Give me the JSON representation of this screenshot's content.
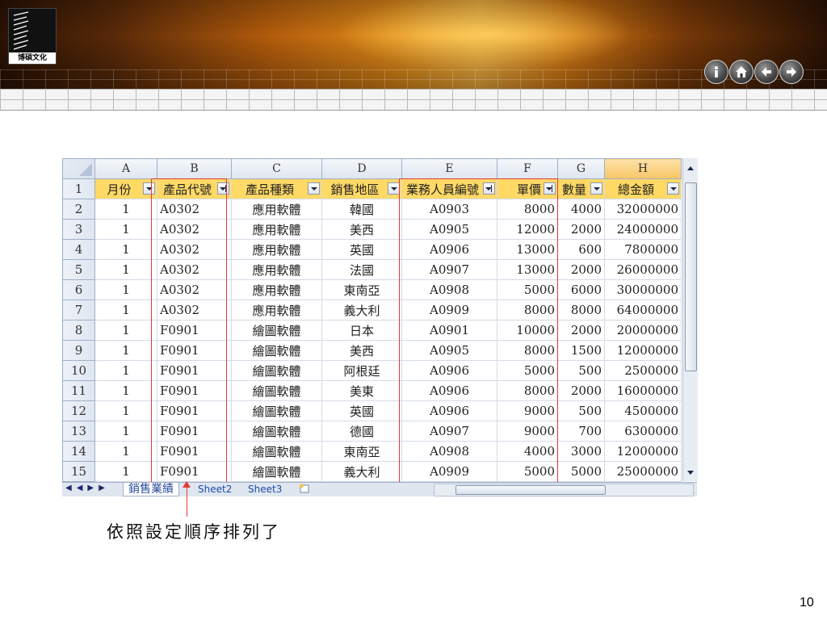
{
  "header": {
    "logo_text": "博碩文化",
    "nav_buttons": [
      "info-icon",
      "home-icon",
      "back-arrow-icon",
      "forward-arrow-icon"
    ]
  },
  "spreadsheet": {
    "column_letters": [
      "A",
      "B",
      "C",
      "D",
      "E",
      "F",
      "G",
      "H"
    ],
    "selected_column": "H",
    "header_row_number": "1",
    "headers": [
      "月份",
      "產品代號",
      "產品種類",
      "銷售地區",
      "業務人員編號",
      "單價",
      "數量",
      "總金額"
    ],
    "sorted_columns": [
      "產品代號",
      "業務人員編號",
      "單價"
    ],
    "rows": [
      {
        "n": "2",
        "cells": [
          "1",
          "A0302",
          "應用軟體",
          "韓國",
          "A0903",
          "8000",
          "4000",
          "32000000"
        ]
      },
      {
        "n": "3",
        "cells": [
          "1",
          "A0302",
          "應用軟體",
          "美西",
          "A0905",
          "12000",
          "2000",
          "24000000"
        ]
      },
      {
        "n": "4",
        "cells": [
          "1",
          "A0302",
          "應用軟體",
          "英國",
          "A0906",
          "13000",
          "600",
          "7800000"
        ]
      },
      {
        "n": "5",
        "cells": [
          "1",
          "A0302",
          "應用軟體",
          "法國",
          "A0907",
          "13000",
          "2000",
          "26000000"
        ]
      },
      {
        "n": "6",
        "cells": [
          "1",
          "A0302",
          "應用軟體",
          "東南亞",
          "A0908",
          "5000",
          "6000",
          "30000000"
        ]
      },
      {
        "n": "7",
        "cells": [
          "1",
          "A0302",
          "應用軟體",
          "義大利",
          "A0909",
          "8000",
          "8000",
          "64000000"
        ]
      },
      {
        "n": "8",
        "cells": [
          "1",
          "F0901",
          "繪圖軟體",
          "日本",
          "A0901",
          "10000",
          "2000",
          "20000000"
        ]
      },
      {
        "n": "9",
        "cells": [
          "1",
          "F0901",
          "繪圖軟體",
          "美西",
          "A0905",
          "8000",
          "1500",
          "12000000"
        ]
      },
      {
        "n": "10",
        "cells": [
          "1",
          "F0901",
          "繪圖軟體",
          "阿根廷",
          "A0906",
          "5000",
          "500",
          "2500000"
        ]
      },
      {
        "n": "11",
        "cells": [
          "1",
          "F0901",
          "繪圖軟體",
          "美東",
          "A0906",
          "8000",
          "2000",
          "16000000"
        ]
      },
      {
        "n": "12",
        "cells": [
          "1",
          "F0901",
          "繪圖軟體",
          "英國",
          "A0906",
          "9000",
          "500",
          "4500000"
        ]
      },
      {
        "n": "13",
        "cells": [
          "1",
          "F0901",
          "繪圖軟體",
          "德國",
          "A0907",
          "9000",
          "700",
          "6300000"
        ]
      },
      {
        "n": "14",
        "cells": [
          "1",
          "F0901",
          "繪圖軟體",
          "東南亞",
          "A0908",
          "4000",
          "3000",
          "12000000"
        ]
      },
      {
        "n": "15",
        "cells": [
          "1",
          "F0901",
          "繪圖軟體",
          "義大利",
          "A0909",
          "5000",
          "5000",
          "25000000"
        ]
      }
    ],
    "sheet_tabs": [
      "銷售業績",
      "Sheet2",
      "Sheet3"
    ],
    "active_tab": "銷售業績"
  },
  "annotation": {
    "caption": "依照設定順序排列了"
  },
  "page_number": "10",
  "colors": {
    "header_fill": "#ffd966",
    "highlight_border": "#e23b3b",
    "banner_orange": "#e08a18"
  }
}
